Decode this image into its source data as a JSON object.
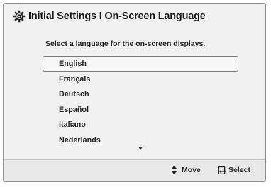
{
  "header": {
    "title": "Initial Settings I On-Screen Language",
    "icon": "gear-icon"
  },
  "prompt": "Select a language for the on-screen displays.",
  "languages": [
    {
      "label": "English",
      "selected": true
    },
    {
      "label": "Français",
      "selected": false
    },
    {
      "label": "Deutsch",
      "selected": false
    },
    {
      "label": "Español",
      "selected": false
    },
    {
      "label": "Italiano",
      "selected": false
    },
    {
      "label": "Nederlands",
      "selected": false
    }
  ],
  "footer": {
    "move_label": "Move",
    "select_label": "Select"
  }
}
